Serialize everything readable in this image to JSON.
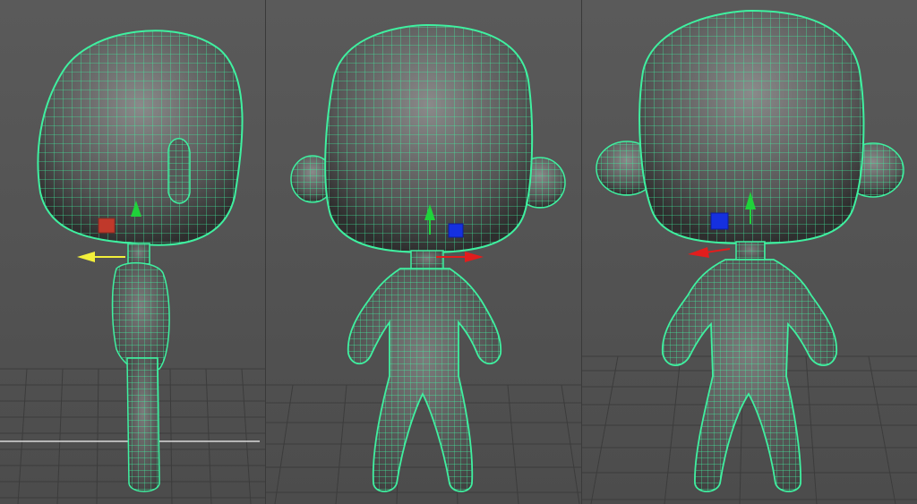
{
  "viewports": [
    {
      "id": "side",
      "view": "side"
    },
    {
      "id": "front",
      "view": "front"
    },
    {
      "id": "persp",
      "view": "perspective"
    }
  ],
  "colors": {
    "background": "#505050",
    "wireframe": "#3ff0a0",
    "grid": "#3c3c3c",
    "axis_x": "#e21d1d",
    "axis_y": "#1fd33a",
    "axis_selected": "#f2ef3a",
    "manip_center_side": "#c0392b",
    "manip_center": "#1530e0"
  },
  "icons": {
    "manipulator": "move-tool-icon",
    "pivot_handle": "pivot-handle-icon"
  }
}
